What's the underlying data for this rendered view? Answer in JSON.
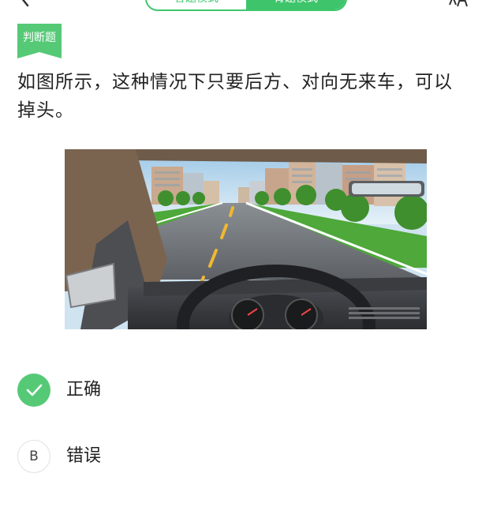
{
  "header": {
    "tabs": [
      {
        "label": "答题模式",
        "active": false
      },
      {
        "label": "背题模式",
        "active": true
      }
    ]
  },
  "question": {
    "type_tag": "判断题",
    "text": "如图所示，这种情况下只要后方、对向无来车，可以掉头。"
  },
  "options": [
    {
      "marker": "",
      "label": "正确",
      "state": "selected-correct"
    },
    {
      "marker": "B",
      "label": "错误",
      "state": "unselected"
    }
  ],
  "colors": {
    "accent": "#3ec56b",
    "correct": "#56c977"
  },
  "icons": {
    "back": "chevron-left-icon",
    "correct": "check-icon",
    "top_right": "font-size-icon"
  }
}
